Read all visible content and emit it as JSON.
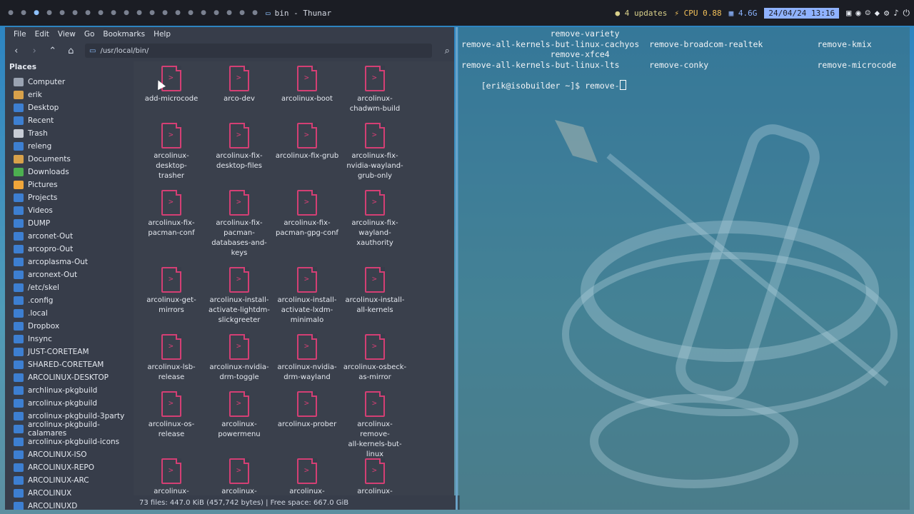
{
  "topbar": {
    "workspaces": [
      "●",
      "●",
      "●",
      "●",
      "●",
      "●",
      "●",
      "●",
      "●",
      "●",
      "●",
      "●",
      "●",
      "●",
      "●",
      "●",
      "●",
      "●",
      "●",
      "●"
    ],
    "window_title": "bin - Thunar",
    "updates": "4 updates",
    "cpu_label": "CPU",
    "cpu_value": "0.88",
    "mem_value": "4.6G",
    "datetime": "24/04/24 13:16"
  },
  "thunar": {
    "menu": [
      "File",
      "Edit",
      "View",
      "Go",
      "Bookmarks",
      "Help"
    ],
    "path": "/usr/local/bin/",
    "places_title": "Places",
    "places": [
      {
        "label": "Computer",
        "icon": "computer-icon",
        "color": "#9aa3b2"
      },
      {
        "label": "erik",
        "icon": "home-icon",
        "color": "#d8a14a"
      },
      {
        "label": "Desktop",
        "icon": "desktop-icon",
        "color": "#3d7fd1"
      },
      {
        "label": "Recent",
        "icon": "recent-icon",
        "color": "#3d7fd1"
      },
      {
        "label": "Trash",
        "icon": "trash-icon",
        "color": "#c7ccd6"
      },
      {
        "label": "releng",
        "icon": "folder-icon",
        "color": "#3d7fd1"
      },
      {
        "label": "Documents",
        "icon": "documents-icon",
        "color": "#d8a14a"
      },
      {
        "label": "Downloads",
        "icon": "downloads-icon",
        "color": "#4caf50"
      },
      {
        "label": "Pictures",
        "icon": "pictures-icon",
        "color": "#f0a63a"
      },
      {
        "label": "Projects",
        "icon": "folder-icon",
        "color": "#3d7fd1"
      },
      {
        "label": "Videos",
        "icon": "videos-icon",
        "color": "#3d7fd1"
      },
      {
        "label": "DUMP",
        "icon": "folder-icon",
        "color": "#3d7fd1"
      },
      {
        "label": "arconet-Out",
        "icon": "folder-icon",
        "color": "#3d7fd1"
      },
      {
        "label": "arcopro-Out",
        "icon": "folder-icon",
        "color": "#3d7fd1"
      },
      {
        "label": "arcoplasma-Out",
        "icon": "folder-icon",
        "color": "#3d7fd1"
      },
      {
        "label": "arconext-Out",
        "icon": "folder-icon",
        "color": "#3d7fd1"
      },
      {
        "label": "/etc/skel",
        "icon": "folder-icon",
        "color": "#3d7fd1"
      },
      {
        "label": ".config",
        "icon": "folder-icon",
        "color": "#3d7fd1"
      },
      {
        "label": ".local",
        "icon": "folder-icon",
        "color": "#3d7fd1"
      },
      {
        "label": "Dropbox",
        "icon": "folder-icon",
        "color": "#3d7fd1"
      },
      {
        "label": "Insync",
        "icon": "folder-icon",
        "color": "#3d7fd1"
      },
      {
        "label": "JUST-CORETEAM",
        "icon": "folder-icon",
        "color": "#3d7fd1"
      },
      {
        "label": "SHARED-CORETEAM",
        "icon": "folder-icon",
        "color": "#3d7fd1"
      },
      {
        "label": "ARCOLINUX-DESKTOP",
        "icon": "folder-icon",
        "color": "#3d7fd1"
      },
      {
        "label": "archlinux-pkgbuild",
        "icon": "folder-icon",
        "color": "#3d7fd1"
      },
      {
        "label": "arcolinux-pkgbuild",
        "icon": "folder-icon",
        "color": "#3d7fd1"
      },
      {
        "label": "arcolinux-pkgbuild-3party",
        "icon": "folder-icon",
        "color": "#3d7fd1"
      },
      {
        "label": "arcolinux-pkgbuild-calamares",
        "icon": "folder-icon",
        "color": "#3d7fd1"
      },
      {
        "label": "arcolinux-pkgbuild-icons",
        "icon": "folder-icon",
        "color": "#3d7fd1"
      },
      {
        "label": "ARCOLINUX-ISO",
        "icon": "folder-icon",
        "color": "#3d7fd1"
      },
      {
        "label": "ARCOLINUX-REPO",
        "icon": "folder-icon",
        "color": "#3d7fd1"
      },
      {
        "label": "ARCOLINUX-ARC",
        "icon": "folder-icon",
        "color": "#3d7fd1"
      },
      {
        "label": "ARCOLINUX",
        "icon": "folder-icon",
        "color": "#3d7fd1"
      },
      {
        "label": "ARCOLINUXD",
        "icon": "folder-icon",
        "color": "#3d7fd1"
      }
    ],
    "files": [
      [
        "add-microcode"
      ],
      [
        "arco-dev"
      ],
      [
        "arcolinux-boot"
      ],
      [
        "arcolinux-",
        "chadwm-build"
      ],
      [
        "arcolinux-desktop-",
        "trasher"
      ],
      [
        "arcolinux-fix-",
        "desktop-files"
      ],
      [
        "arcolinux-fix-grub"
      ],
      [
        "arcolinux-fix-",
        "nvidia-wayland-",
        "grub-only"
      ],
      [
        "arcolinux-fix-",
        "pacman-conf"
      ],
      [
        "arcolinux-fix-",
        "pacman-",
        "databases-and-",
        "keys"
      ],
      [
        "arcolinux-fix-",
        "pacman-gpg-conf"
      ],
      [
        "arcolinux-fix-",
        "wayland-",
        "xauthority"
      ],
      [
        "arcolinux-get-",
        "mirrors"
      ],
      [
        "arcolinux-install-",
        "activate-lightdm-",
        "slickgreeter"
      ],
      [
        "arcolinux-install-",
        "activate-lxdm-",
        "minimalo"
      ],
      [
        "arcolinux-install-",
        "all-kernels"
      ],
      [
        "arcolinux-lsb-",
        "release"
      ],
      [
        "arcolinux-nvidia-",
        "drm-toggle"
      ],
      [
        "arcolinux-nvidia-",
        "drm-wayland"
      ],
      [
        "arcolinux-osbeck-",
        "as-mirror"
      ],
      [
        "arcolinux-os-",
        "release"
      ],
      [
        "arcolinux-",
        "powermenu"
      ],
      [
        "arcolinux-prober"
      ],
      [
        "arcolinux-remove-",
        "all-kernels-but-",
        "linux"
      ],
      [
        "arcolinux-remove-"
      ],
      [
        "arcolinux-remove-"
      ],
      [
        "arcolinux-remove-"
      ],
      [
        "arcolinux-remove-"
      ]
    ],
    "status": "73 files: 447.0 KiB (457,742 bytes)  |  Free space: 667.0 GiB"
  },
  "terminal": {
    "lines": [
      {
        "text": "                  remove-variety"
      },
      {
        "text": "remove-all-kernels-but-linux-cachyos  remove-broadcom-realtek           remove-kmix"
      },
      {
        "text": "                  remove-xfce4"
      },
      {
        "text": "remove-all-kernels-but-linux-lts      remove-conky                      remove-microcode"
      }
    ],
    "prompt": "[erik@isobuilder ~]$ remove-"
  }
}
